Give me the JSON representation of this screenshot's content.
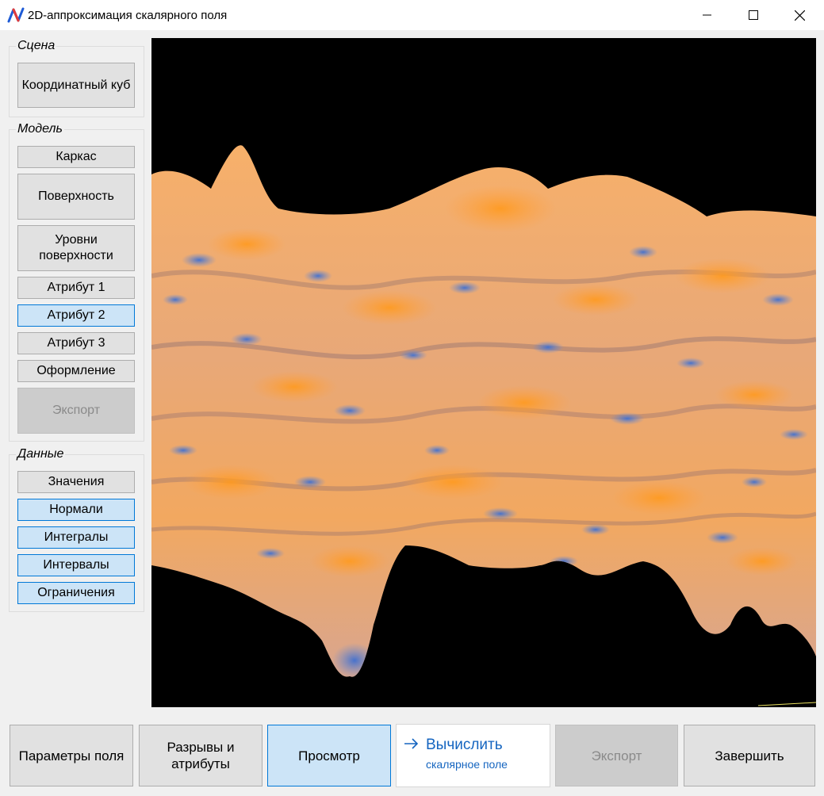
{
  "window": {
    "title": "2D-аппроксимация скалярного поля",
    "app_icon": "app-logo-icon",
    "controls": [
      "minimize-icon",
      "maximize-icon",
      "close-icon"
    ]
  },
  "sidebar": {
    "scene": {
      "label": "Сцена",
      "buttons": [
        {
          "label": "Координатный куб",
          "state": "normal"
        }
      ]
    },
    "model": {
      "label": "Модель",
      "buttons": [
        {
          "label": "Каркас",
          "state": "normal"
        },
        {
          "label": "Поверхность",
          "state": "normal"
        },
        {
          "label": "Уровни поверхности",
          "state": "normal"
        },
        {
          "label": "Атрибут 1",
          "state": "normal"
        },
        {
          "label": "Атрибут 2",
          "state": "active"
        },
        {
          "label": "Атрибут 3",
          "state": "normal"
        },
        {
          "label": "Оформление",
          "state": "normal"
        },
        {
          "label": "Экспорт",
          "state": "disabled"
        }
      ]
    },
    "data": {
      "label": "Данные",
      "buttons": [
        {
          "label": "Значения",
          "state": "normal"
        },
        {
          "label": "Нормали",
          "state": "active"
        },
        {
          "label": "Интегралы",
          "state": "active"
        },
        {
          "label": "Интервалы",
          "state": "active"
        },
        {
          "label": "Ограничения",
          "state": "active"
        }
      ]
    }
  },
  "viewport": {
    "background": "#000000",
    "surface_color_high": "#ffa340",
    "surface_color_low": "#4a78c8"
  },
  "bottom_bar": {
    "field_params": "Параметры поля",
    "breaks_attrs": "Разрывы и атрибуты",
    "preview": "Просмотр",
    "compute_title": "Вычислить",
    "compute_subtitle": "скалярное поле",
    "export": "Экспорт",
    "finish": "Завершить"
  },
  "colors": {
    "accent": "#0078d7",
    "active_bg": "#cce4f7",
    "command_link": "#1565c0"
  }
}
